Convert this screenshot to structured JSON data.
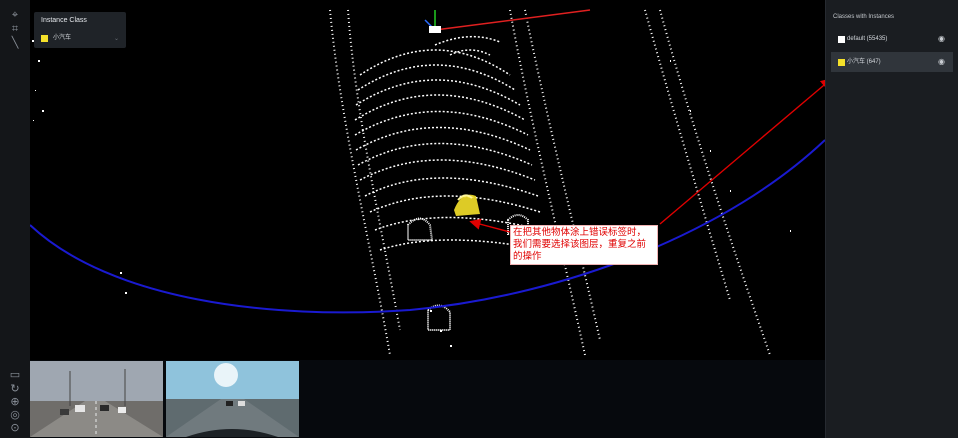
{
  "instance_class_panel": {
    "title": "Instance Class",
    "selected_class": "小汽车",
    "selected_color": "#f5e12a"
  },
  "classes_panel": {
    "title": "Classes with Instances",
    "classes": [
      {
        "label": "default (55435)",
        "color": "#ffffff",
        "selected": false
      },
      {
        "label": "小汽车 (647)",
        "color": "#f5e12a",
        "selected": true
      }
    ]
  },
  "annotation": {
    "text": "在把其他物体涂上错误标签时，我们需要选择该图层，重复之前的操作"
  },
  "toolbar": {
    "top_icons": [
      "select-icon",
      "grid-icon",
      "line-tool-icon"
    ],
    "bottom_icons": [
      "monitor-icon",
      "rotate-icon",
      "zoom-icon",
      "fit-view-icon",
      "settings-view-icon"
    ]
  },
  "colors": {
    "annotation_red": "#e00000",
    "trajectory_blue": "#1a1ad0",
    "highlight_yellow": "#f5e12a"
  }
}
